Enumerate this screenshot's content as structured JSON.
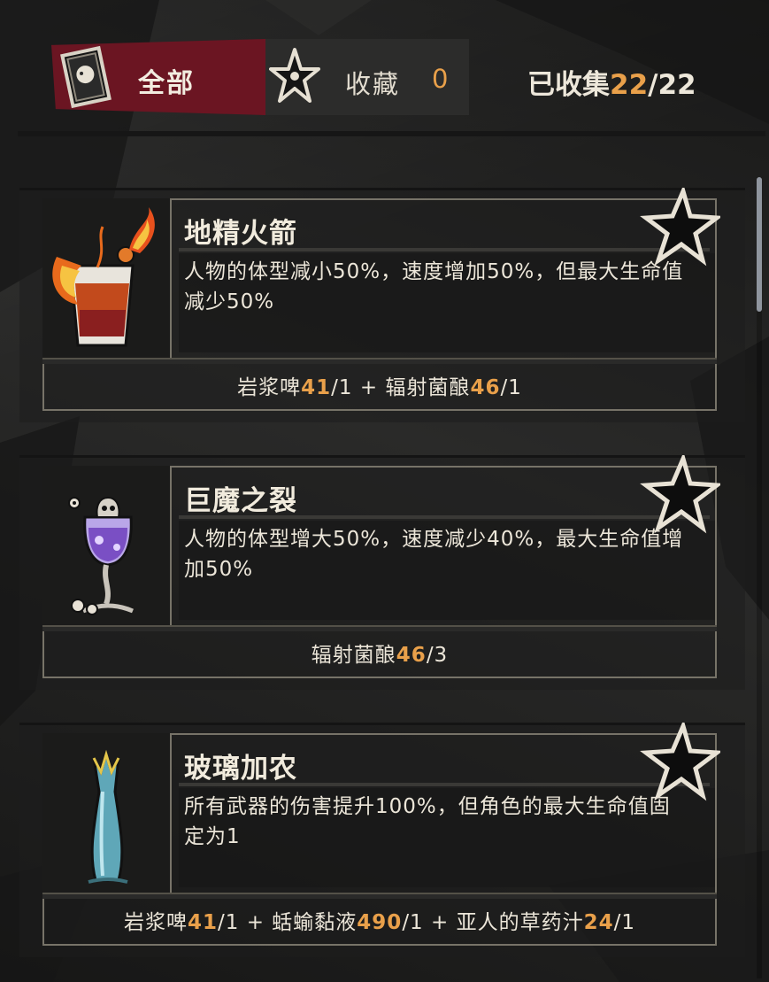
{
  "tabs": {
    "all_label": "全部",
    "favorites_label": "收藏",
    "favorites_count": "0"
  },
  "collection": {
    "label": "已收集",
    "collected": "22",
    "separator": "/",
    "total": "22"
  },
  "colors": {
    "accent": "#e9a04a",
    "active_tab": "#6b1522",
    "text": "#ece6d9"
  },
  "cards": [
    {
      "title": "地精火箭",
      "description": "人物的体型减小50%，速度增加50%，但最大生命值减少50%",
      "icon": "fire-cocktail-icon",
      "recipe": [
        {
          "name": "岩浆啤",
          "owned": "41",
          "need": "/1"
        },
        {
          "name": "辐射菌酿",
          "owned": "46",
          "need": "/1"
        }
      ]
    },
    {
      "title": "巨魔之裂",
      "description": "人物的体型增大50%，速度减少40%，最大生命值增加50%",
      "icon": "purple-goblet-icon",
      "recipe": [
        {
          "name": "辐射菌酿",
          "owned": "46",
          "need": "/3"
        }
      ]
    },
    {
      "title": "玻璃加农",
      "description": "所有武器的伤害提升100%，但角色的最大生命值固定为1",
      "icon": "glass-vase-icon",
      "recipe": [
        {
          "name": "岩浆啤",
          "owned": "41",
          "need": "/1"
        },
        {
          "name": "蛞蝓黏液",
          "owned": "490",
          "need": "/1"
        },
        {
          "name": "亚人的草药汁",
          "owned": "24",
          "need": "/1"
        }
      ]
    }
  ],
  "plus": "+"
}
